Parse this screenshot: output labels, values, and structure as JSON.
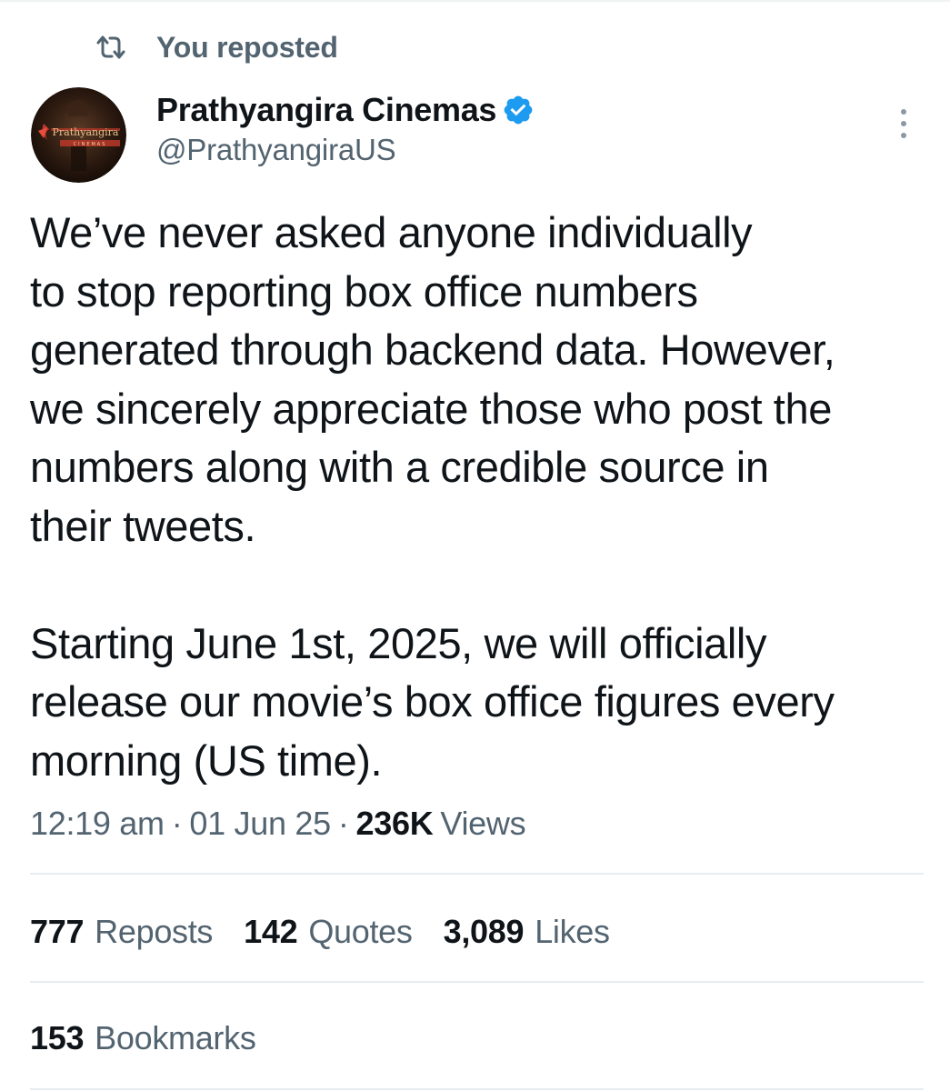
{
  "colors": {
    "text_primary": "#0f1419",
    "text_secondary": "#536471",
    "verified_blue": "#1d9bf0",
    "divider": "#e6ecf0"
  },
  "repost_context": {
    "icon": "repost-icon",
    "label": "You reposted"
  },
  "author": {
    "avatar_icon": "avatar",
    "avatar_logo_text": "Prathyangira",
    "avatar_logo_subtext": "CINEMAS",
    "display_name": "Prathyangira Cinemas",
    "verified_icon": "verified-badge-icon",
    "handle": "@PrathyangiraUS"
  },
  "more_menu": {
    "icon": "more-vertical-icon"
  },
  "tweet": {
    "lines": [
      "We’ve never asked anyone individually",
      "to stop reporting box office numbers",
      "generated through backend data. However,",
      "we sincerely appreciate those who post the",
      "numbers along with a credible source in",
      "their tweets.",
      "Starting June 1st, 2025, we will officially",
      "release our movie’s box office figures every",
      "morning (US time)."
    ]
  },
  "meta": {
    "time": "12:19 am",
    "separator": "·",
    "date": "01 Jun 25",
    "views_count": "236K",
    "views_label": "Views"
  },
  "stats": {
    "reposts": {
      "count": "777",
      "label": "Reposts"
    },
    "quotes": {
      "count": "142",
      "label": "Quotes"
    },
    "likes": {
      "count": "3,089",
      "label": "Likes"
    }
  },
  "bookmarks": {
    "count": "153",
    "label": "Bookmarks"
  }
}
